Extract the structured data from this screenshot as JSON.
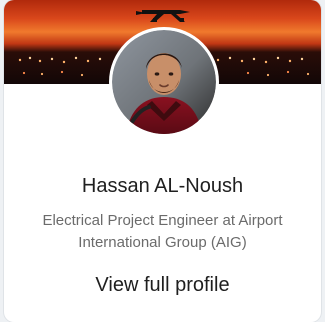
{
  "profile_card": {
    "name": "Hassan AL-Noush",
    "headline": "Electrical Project Engineer at Airport International Group (AIG)",
    "cta_label": "View full profile",
    "banner": {
      "icon_name": "airplane-runway-banner"
    },
    "avatar": {
      "icon_name": "profile-photo"
    },
    "colors": {
      "name": "#1f1f1f",
      "headline": "#6b6b6b",
      "cta": "#1f1f1f",
      "card_background": "#ffffff",
      "banner_accent": "#d9471b"
    }
  }
}
